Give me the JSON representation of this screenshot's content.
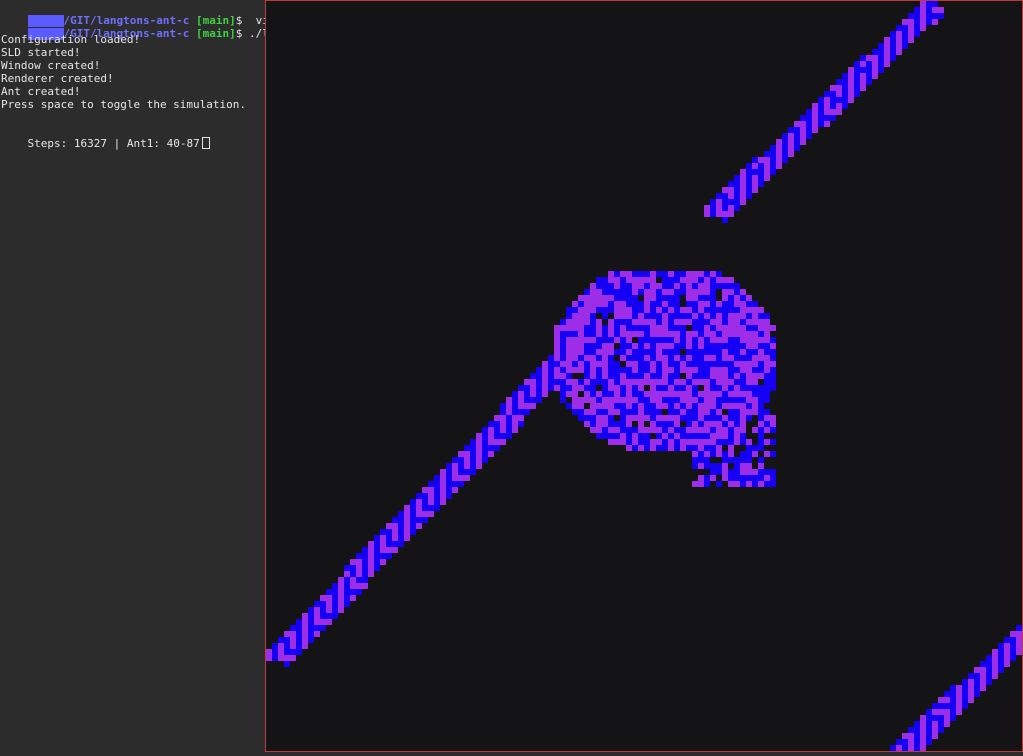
{
  "terminal": {
    "prompt_user_color": "#5b5bff",
    "lines": [
      {
        "type": "prompt",
        "path": "/GIT/langtons-ant-c",
        "branch": "[main]",
        "dollar": "$",
        "command": "  vim"
      },
      {
        "type": "prompt",
        "path": "/GIT/langtons-ant-c",
        "branch": "[main]",
        "dollar": "$",
        "command": " ./lar"
      },
      {
        "type": "text",
        "text": "Configuration loaded!"
      },
      {
        "type": "text",
        "text": "SLD started!"
      },
      {
        "type": "text",
        "text": "Window created!"
      },
      {
        "type": "text",
        "text": "Renderer created!"
      },
      {
        "type": "text",
        "text": "Ant created!"
      },
      {
        "type": "text",
        "text": "Press space to toggle the simulation."
      },
      {
        "type": "blank",
        "text": ""
      },
      {
        "type": "status",
        "text": "Steps: 16327 | Ant1: 40-87"
      }
    ]
  },
  "simulation": {
    "background": "#141417",
    "border_color": "#c03a3a",
    "cell_colors": [
      "#1500f5",
      "#9d2de6"
    ]
  }
}
